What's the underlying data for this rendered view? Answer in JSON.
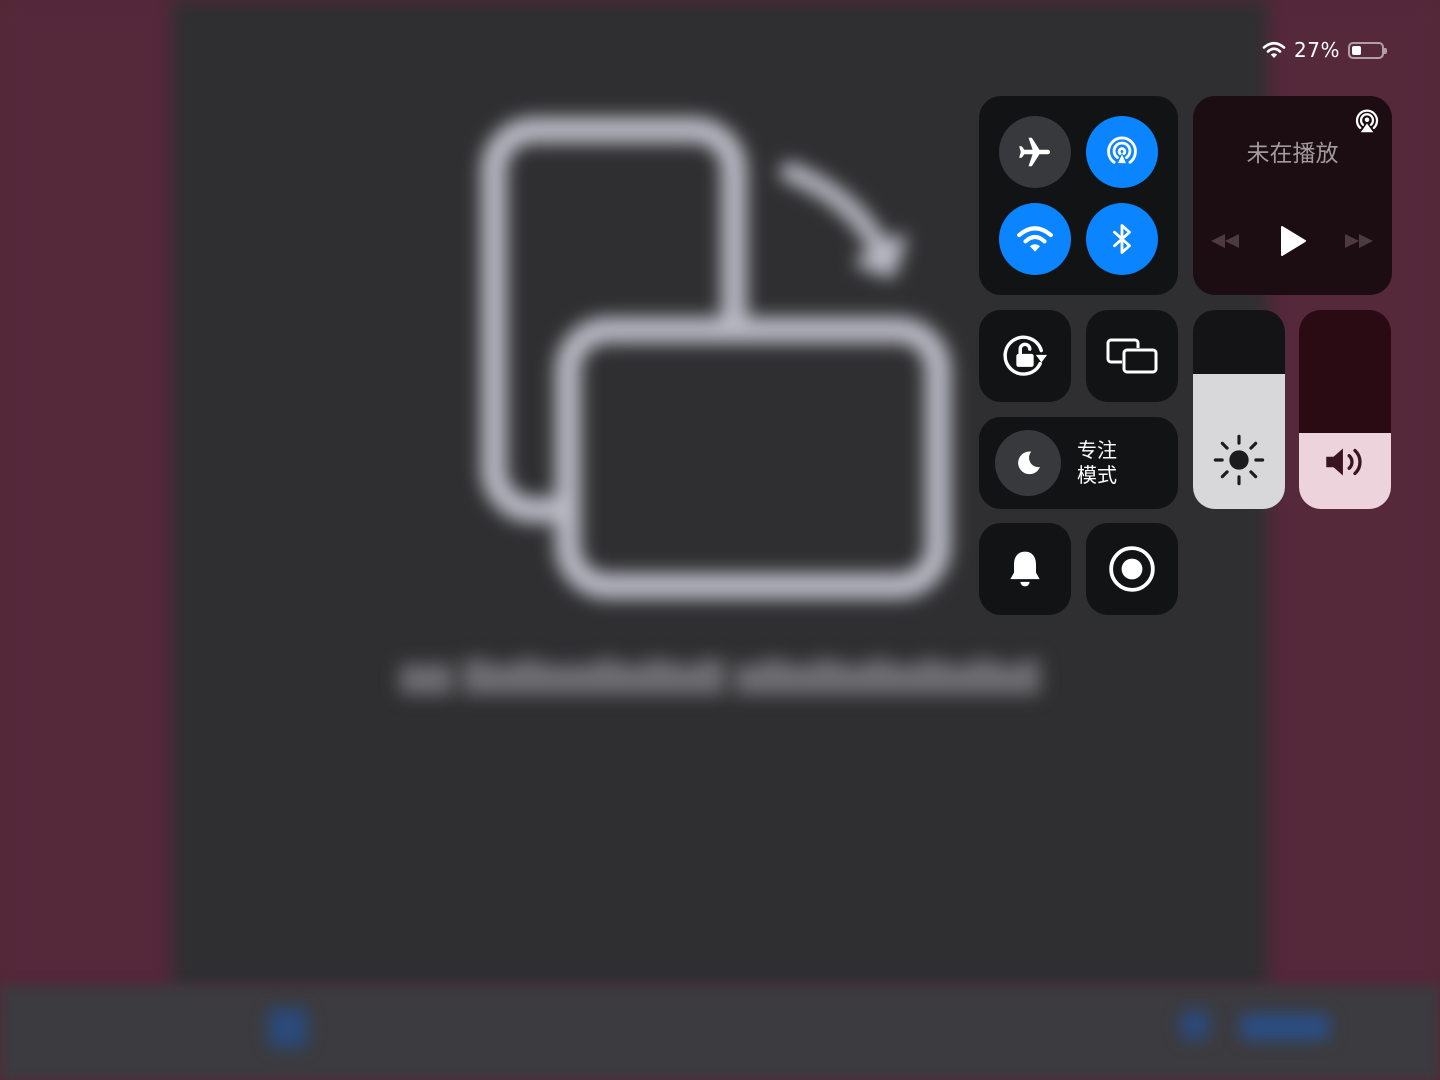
{
  "status_bar": {
    "wifi_icon": "wifi-icon",
    "battery_percent_text": "27%",
    "battery_level": 0.27
  },
  "connectivity": {
    "airplane_mode": {
      "icon": "airplane-icon",
      "on": false
    },
    "airdrop": {
      "icon": "airdrop-icon",
      "on": true
    },
    "wifi": {
      "icon": "wifi-icon",
      "on": true
    },
    "bluetooth": {
      "icon": "bluetooth-icon",
      "on": true
    }
  },
  "now_playing": {
    "title": "未在播放",
    "airplay_icon": "airplay-icon",
    "controls": [
      "rewind-icon",
      "play-icon",
      "fast-forward-icon"
    ]
  },
  "toggles": {
    "rotation_lock_icon": "rotation-lock-icon",
    "screen_mirroring_icon": "screen-mirroring-icon",
    "silent_mode_icon": "bell-icon",
    "screen_record_icon": "screen-record-icon"
  },
  "focus": {
    "label_line1": "专注",
    "label_line2": "模式",
    "icon": "moon-icon"
  },
  "sliders": {
    "brightness": {
      "level": 0.68,
      "icon": "sun-icon"
    },
    "volume": {
      "level": 0.38,
      "icon": "speaker-icon"
    }
  },
  "colors": {
    "accent_on": "#0a84ff",
    "tile_background": "#121315",
    "background_side": "#55283a"
  }
}
